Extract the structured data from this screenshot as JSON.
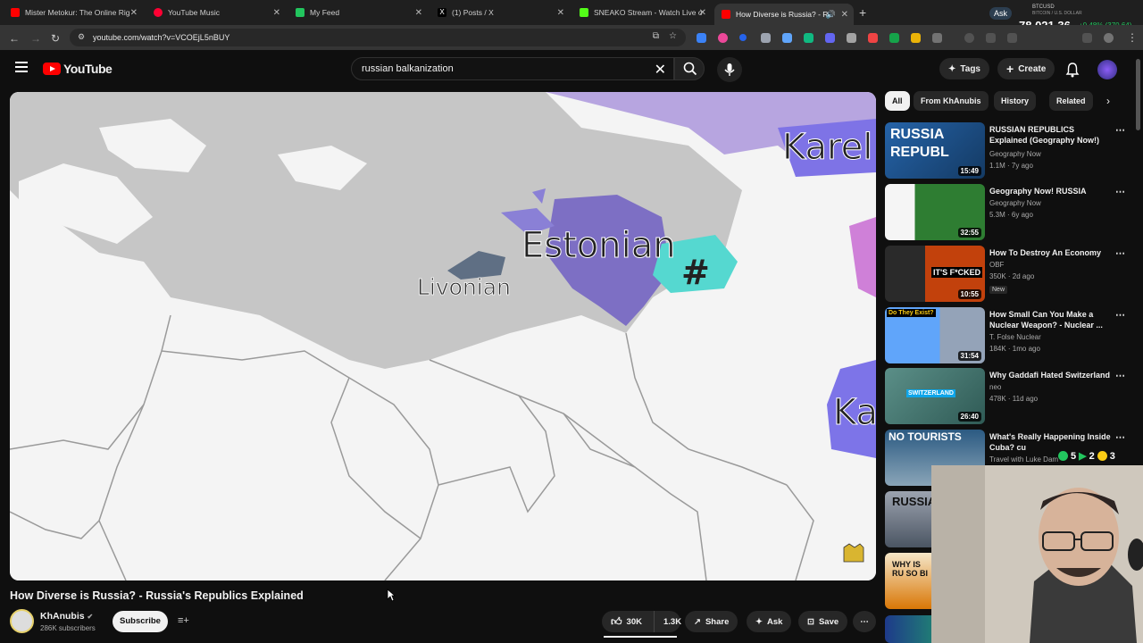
{
  "browser": {
    "tabs": [
      {
        "title": "Mister Metokur: The Online Rig",
        "favicon_color": "#ff0000"
      },
      {
        "title": "YouTube Music",
        "favicon_color": "#ff0033"
      },
      {
        "title": "My Feed",
        "favicon_color": "#22c55e"
      },
      {
        "title": "(1) Posts / X",
        "favicon_color": "#000000"
      },
      {
        "title": "SNEAKO Stream - Watch Live o",
        "favicon_color": "#53fc18"
      },
      {
        "title": "How Diverse is Russia? - Ru",
        "favicon_color": "#ff0000"
      }
    ],
    "url": "youtube.com/watch?v=VCOEjL5nBUY",
    "ticker": {
      "ask": "Ask",
      "symbol": "BTCUSD",
      "sub": "BITCOIN / U.S. DOLLAR",
      "price": "78,021.36",
      "change": "+0.48% (370.64)"
    }
  },
  "youtube": {
    "logo": "YouTube",
    "search_query": "russian balkanization",
    "tags_label": "Tags",
    "create_label": "Create"
  },
  "video": {
    "map_labels": {
      "estonian": "Estonian",
      "livonian": "Livonian",
      "karelian": "Karel",
      "ka": "Ka",
      "hash": "#"
    },
    "title": "How Diverse is Russia? - Russia's Republics Explained",
    "channel": "KhAnubis",
    "subscribers": "286K subscribers",
    "subscribe_label": "Subscribe",
    "likes": "30K",
    "dislikes": "1.3K",
    "share_label": "Share",
    "ask_label": "Ask",
    "save_label": "Save"
  },
  "chips": [
    "All",
    "From KhAnubis",
    "History",
    "Related"
  ],
  "recommendations": [
    {
      "title": "RUSSIAN REPUBLICS Explained (Geography Now!)",
      "channel": "Geography Now",
      "meta": "1.1M · 7y ago",
      "duration": "15:49",
      "thumb_text": "RUSSIA REPUBL",
      "thumb_color": "#1d4e89"
    },
    {
      "title": "Geography Now! RUSSIA",
      "channel": "Geography Now",
      "meta": "5.3M · 6y ago",
      "duration": "32:55",
      "thumb_text": "",
      "thumb_color": "#2e7d32"
    },
    {
      "title": "How To Destroy An Economy",
      "channel": "OBF",
      "meta": "350K · 2d ago",
      "duration": "10:55",
      "thumb_text": "IT'S F*CKED",
      "thumb_color": "#7a2d12",
      "badge": "New"
    },
    {
      "title": "How Small Can You Make a Nuclear Weapon? - Nuclear ...",
      "channel": "T. Folse Nuclear",
      "meta": "184K · 1mo ago",
      "duration": "31:54",
      "thumb_text": "Do They Exist?",
      "thumb_color": "#3b82c4"
    },
    {
      "title": "Why Gaddafi Hated Switzerland",
      "channel": "neo",
      "meta": "478K · 11d ago",
      "duration": "26:40",
      "thumb_text": "SWITZERLAND",
      "thumb_color": "#4a7f7a"
    },
    {
      "title": "What's Really Happening Inside Cuba? cu",
      "channel": "Travel with Luke Dam",
      "meta": "",
      "duration": "",
      "thumb_text": "NO TOURISTS",
      "thumb_color": "#4b6f91"
    },
    {
      "title": "",
      "channel": "",
      "meta": "",
      "duration": "",
      "thumb_text": "RUSSIA",
      "thumb_color": "#6b7280"
    },
    {
      "title": "",
      "channel": "",
      "meta": "",
      "duration": "",
      "thumb_text": "WHY IS RU SO BI",
      "thumb_color": "#b45309"
    }
  ],
  "stream_overlay": {
    "v1": "5",
    "v2": "2",
    "v3": "3"
  }
}
